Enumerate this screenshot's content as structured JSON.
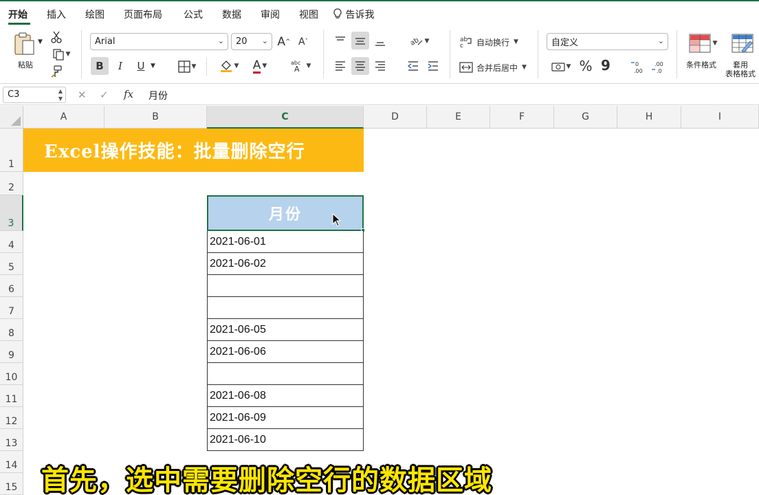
{
  "tabs": [
    "开始",
    "插入",
    "绘图",
    "页面布局",
    "公式",
    "数据",
    "审阅",
    "视图"
  ],
  "tell_me": "告诉我",
  "ribbon": {
    "paste_label": "粘贴",
    "font_name": "Arial",
    "font_size": "20",
    "bold": "B",
    "italic": "I",
    "underline": "U",
    "font_color_glyph": "A",
    "wrap_text": "自动换行",
    "merge_center": "合并后居中",
    "number_format": "自定义",
    "percent": "%",
    "comma": "9",
    "conditional_format": "条件格式",
    "table_format_line1": "套用",
    "table_format_line2": "表格格式"
  },
  "formula_bar": {
    "cell_ref": "C3",
    "fx": "fx",
    "value": "月份"
  },
  "grid": {
    "columns": [
      "A",
      "B",
      "C",
      "D",
      "E",
      "F",
      "G",
      "H",
      "I"
    ],
    "selected_column": "C",
    "rows": [
      "1",
      "2",
      "3",
      "4",
      "5",
      "6",
      "7",
      "8",
      "9",
      "10",
      "11",
      "12",
      "13",
      "14",
      "15"
    ],
    "selected_row": "3",
    "banner_title": "Excel操作技能：批量删除空行",
    "header": "月份",
    "dates": [
      "2021-06-01",
      "2021-06-02",
      "",
      "",
      "2021-06-05",
      "2021-06-06",
      "",
      "2021-06-08",
      "2021-06-09",
      "2021-06-10"
    ]
  },
  "caption": "首先，选中需要删除空行的数据区域",
  "colors": {
    "accent": "#1e7145",
    "banner": "#fdb913",
    "header_fill": "#b7d2ec",
    "caption": "#ffe600"
  }
}
